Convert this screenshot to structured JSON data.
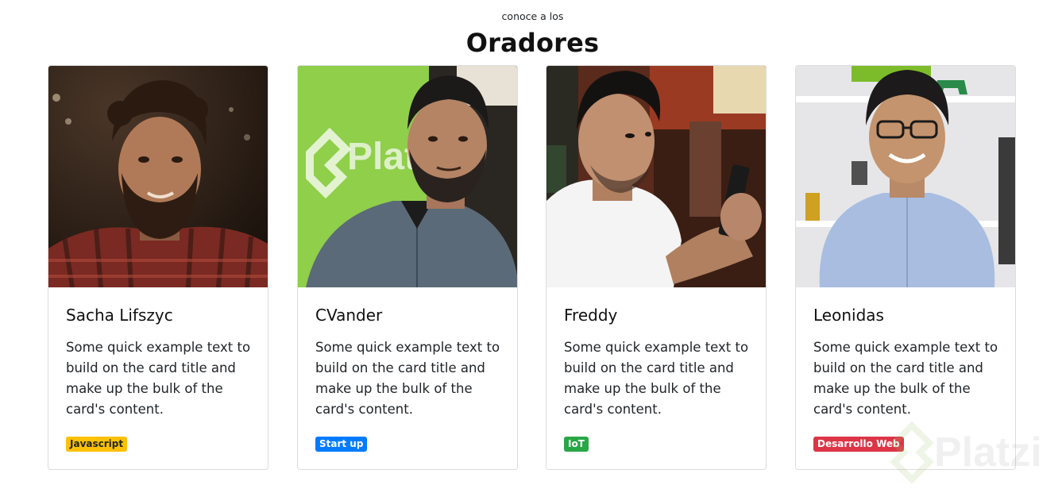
{
  "header": {
    "subtitle": "conoce a los",
    "title": "Oradores"
  },
  "cards": [
    {
      "name": "Sacha Lifszyc",
      "text": "Some quick example text to build on the card title and make up the bulk of the card's content.",
      "badge": "Javascript",
      "badge_bg": "#ffc107",
      "badge_fg": "#212529"
    },
    {
      "name": "CVander",
      "text": "Some quick example text to build on the card title and make up the bulk of the card's content.",
      "badge": "Start up",
      "badge_bg": "#007bff",
      "badge_fg": "#ffffff"
    },
    {
      "name": "Freddy",
      "text": "Some quick example text to build on the card title and make up the bulk of the card's content.",
      "badge": "IoT",
      "badge_bg": "#28a745",
      "badge_fg": "#ffffff"
    },
    {
      "name": "Leonidas",
      "text": "Some quick example text to build on the card title and make up the bulk of the card's content.",
      "badge": "Desarrollo Web",
      "badge_bg": "#dc3545",
      "badge_fg": "#ffffff"
    }
  ],
  "watermark": {
    "text": "Platzi"
  }
}
